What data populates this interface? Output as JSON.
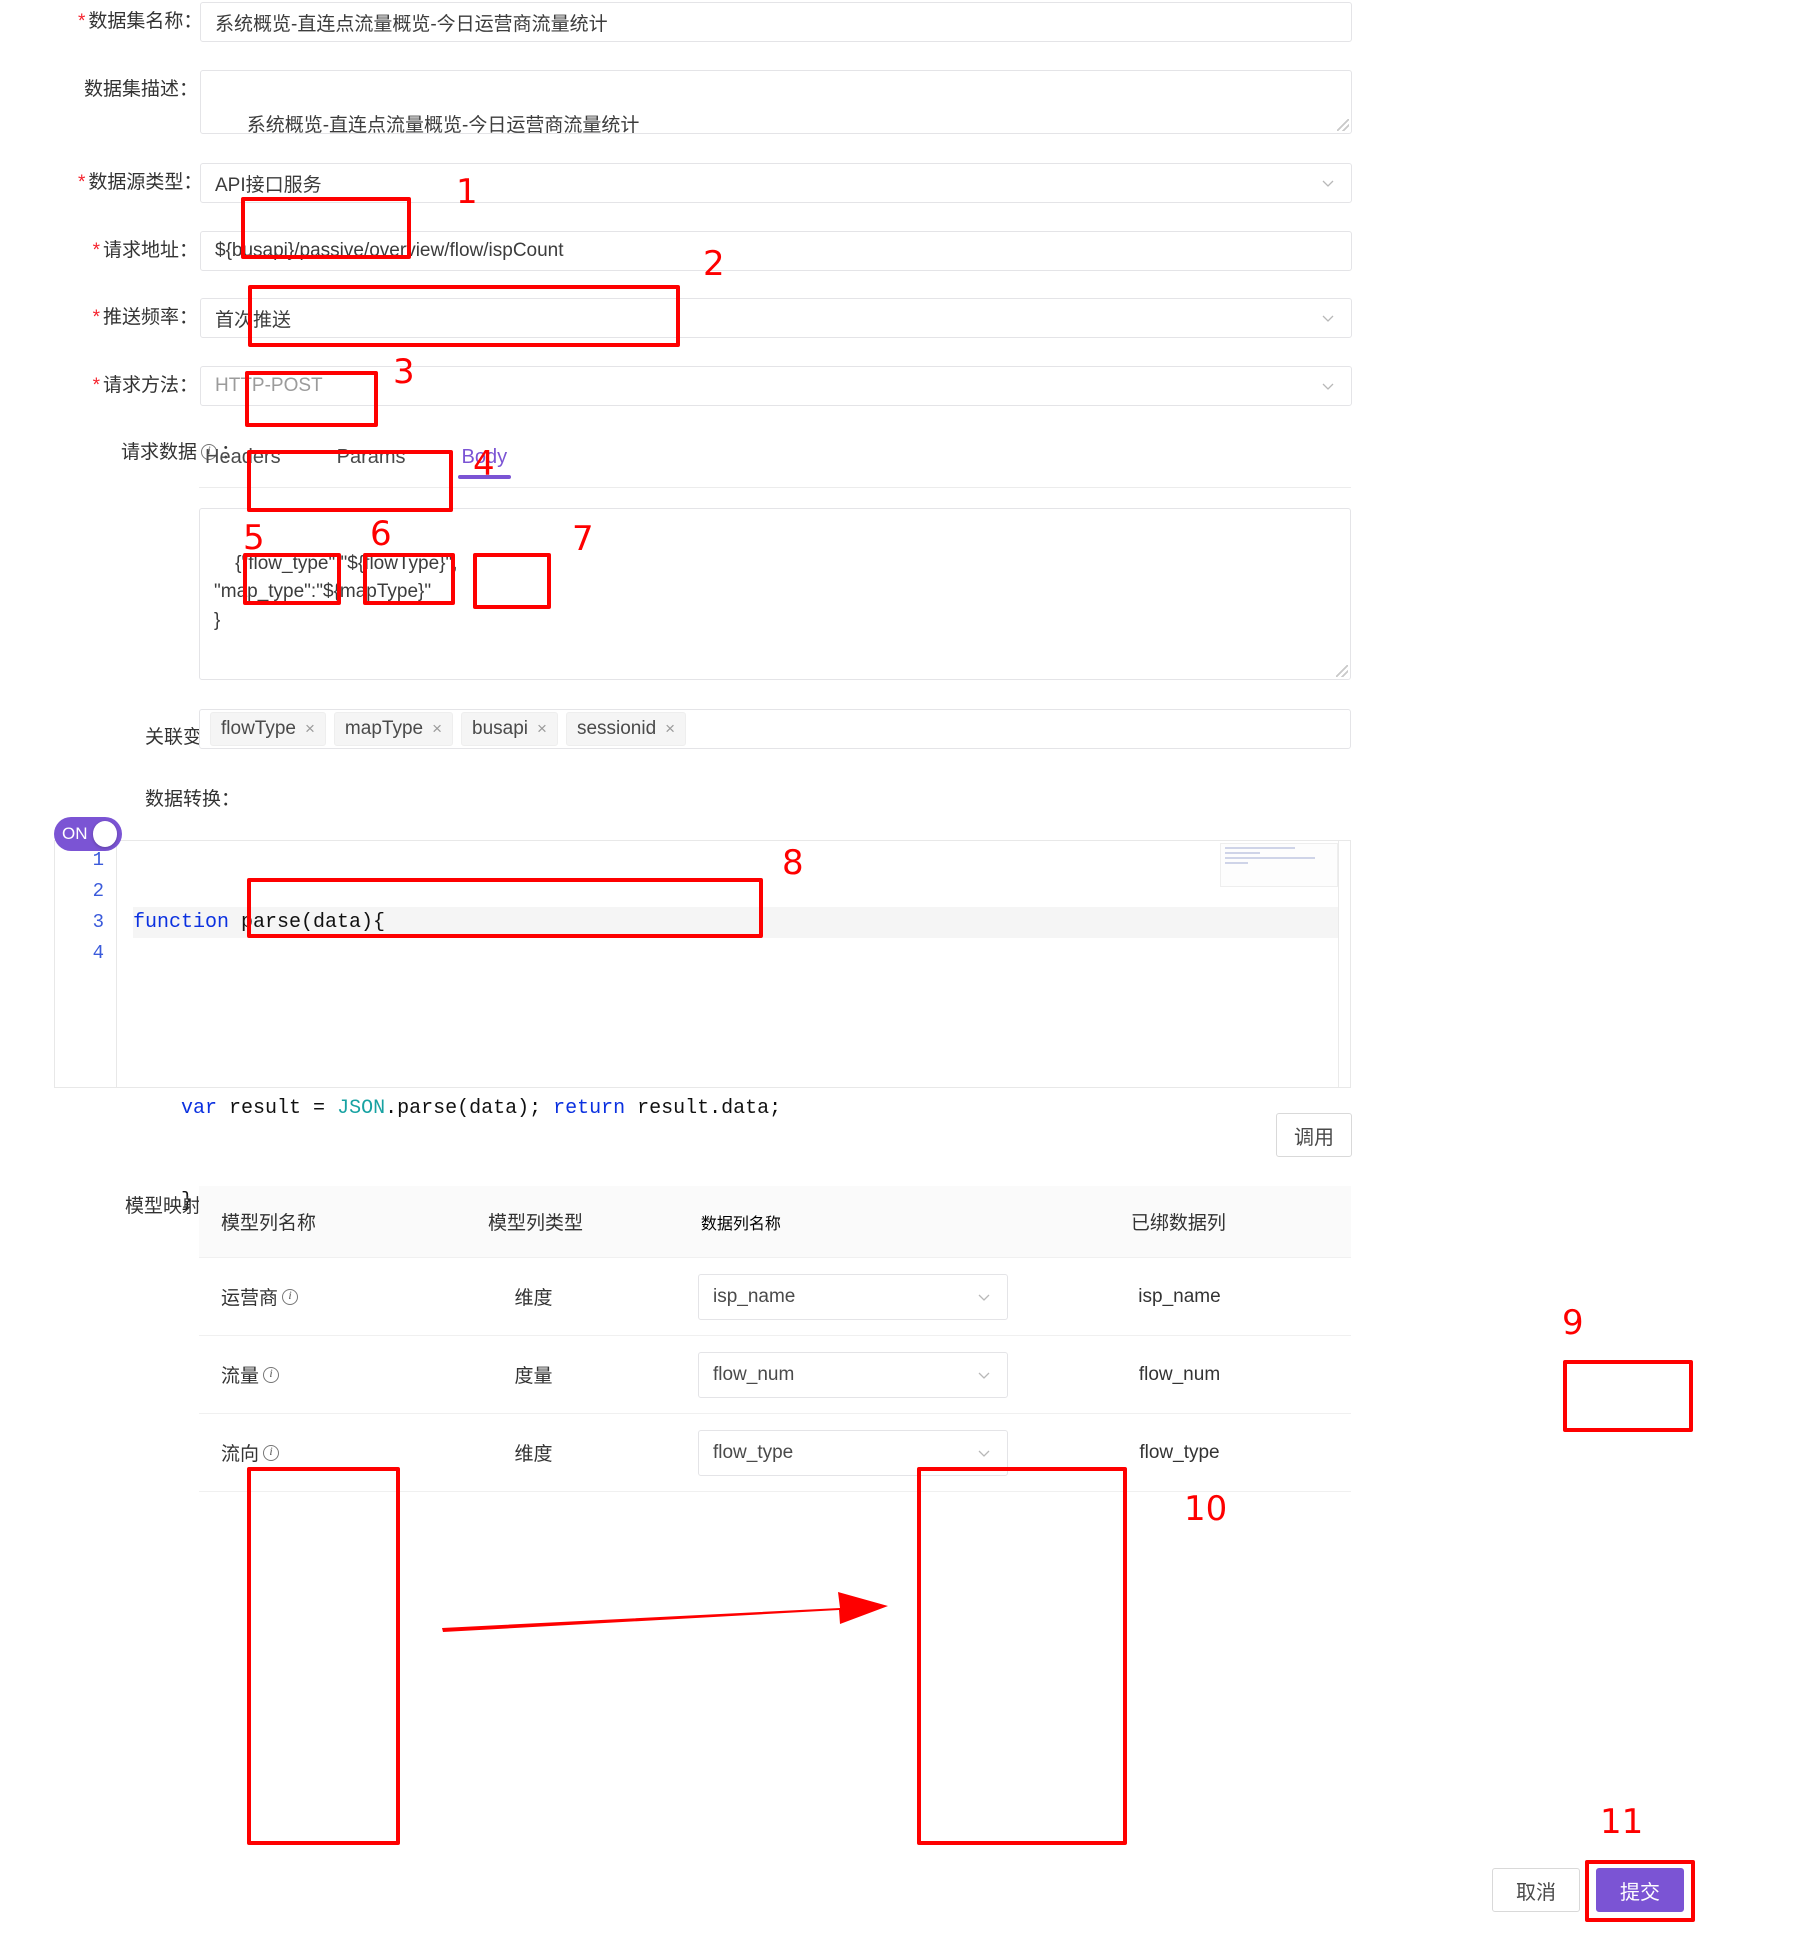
{
  "form": {
    "dataset_name": {
      "label": "数据集名称：",
      "required": true,
      "value": "系统概览-直连点流量概览-今日运营商流量统计"
    },
    "dataset_desc": {
      "label": "数据集描述：",
      "required": false,
      "value": "系统概览-直连点流量概览-今日运营商流量统计"
    },
    "source_type": {
      "label": "数据源类型：",
      "required": true,
      "value": "API接口服务"
    },
    "request_url": {
      "label": "请求地址：",
      "required": true,
      "value": "${busapi}/passive/overview/flow/ispCount"
    },
    "push_freq": {
      "label": "推送频率：",
      "required": true,
      "value": "首次推送"
    },
    "request_method": {
      "label": "请求方法：",
      "required": true,
      "value": "HTTP-POST"
    },
    "request_data": {
      "label": "请求数据",
      "label_suffix": "：",
      "info_icon": "info-circle-icon"
    },
    "related_vars": {
      "label": "关联变量："
    },
    "data_transform": {
      "label": "数据转换："
    },
    "model_mapping": {
      "label": "模型映射："
    }
  },
  "tabs": [
    {
      "id": "headers",
      "label": "Headers",
      "active": false
    },
    {
      "id": "params",
      "label": "Params",
      "active": false
    },
    {
      "id": "body",
      "label": "Body",
      "active": true
    }
  ],
  "body_editor": {
    "value": "{\"flow_type\":\"${flowType}\",\n\"map_type\":\"${mapType}\"\n}"
  },
  "variable_tags": [
    {
      "label": "flowType",
      "remove": "×"
    },
    {
      "label": "mapType",
      "remove": "×"
    },
    {
      "label": "busapi",
      "remove": "×"
    },
    {
      "label": "sessionid",
      "remove": "×"
    }
  ],
  "transform_toggle": {
    "state_label": "ON",
    "on": true
  },
  "code": {
    "lines": [
      {
        "no": "1",
        "tokens": [
          {
            "t": "function",
            "c": "k"
          },
          {
            "t": " parse(data){",
            "c": ""
          }
        ]
      },
      {
        "no": "2",
        "tokens": [
          {
            "t": "",
            "c": ""
          }
        ]
      },
      {
        "no": "3",
        "tokens": [
          {
            "t": "    ",
            "c": ""
          },
          {
            "t": "var",
            "c": "k"
          },
          {
            "t": " result = ",
            "c": ""
          },
          {
            "t": "JSON",
            "c": "t"
          },
          {
            "t": ".parse(data); ",
            "c": ""
          },
          {
            "t": "return",
            "c": "k"
          },
          {
            "t": " result.data;",
            "c": ""
          }
        ]
      },
      {
        "no": "4",
        "tokens": [
          {
            "t": "    }",
            "c": ""
          }
        ]
      }
    ]
  },
  "buttons": {
    "invoke": "调用",
    "cancel": "取消",
    "submit": "提交"
  },
  "mapping_table": {
    "headers": [
      "模型列名称",
      "模型列类型",
      "数据列名称",
      "已绑数据列"
    ],
    "rows": [
      {
        "model_col": "运营商",
        "info_icon": "info-circle-icon",
        "col_type": "维度",
        "data_col": "isp_name",
        "bound_col": "isp_name"
      },
      {
        "model_col": "流量",
        "info_icon": "info-circle-icon",
        "col_type": "度量",
        "data_col": "flow_num",
        "bound_col": "flow_num"
      },
      {
        "model_col": "流向",
        "info_icon": "info-circle-icon",
        "col_type": "维度",
        "data_col": "flow_type",
        "bound_col": "flow_type"
      }
    ]
  },
  "annotations": {
    "numbers": [
      "1",
      "2",
      "3",
      "4",
      "5",
      "6",
      "7",
      "8",
      "9",
      "10",
      "11"
    ]
  },
  "colors": {
    "accent": "#7b54d4",
    "annotation": "#fe0000",
    "required": "#f5222d",
    "border": "#e4e4e7"
  }
}
